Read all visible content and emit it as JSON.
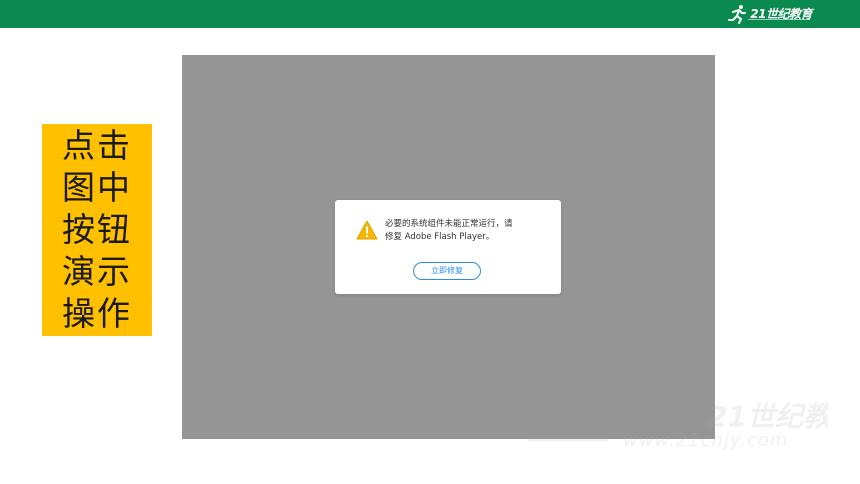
{
  "header": {
    "brand_logo_text": "21世纪教育",
    "brand_url_text": "www.21cnjy.com"
  },
  "side_label": {
    "lines": [
      "点击",
      "图中",
      "按钮",
      "演示",
      "操作"
    ]
  },
  "dialog": {
    "message_line1": "必要的系统组件未能正常运行，请",
    "message_line2": "修复 Adobe Flash Player。",
    "button_label": "立即修复",
    "icon": "warning-icon"
  },
  "watermark": {
    "text": "21世纪教育",
    "url_text": "www.21cnjy.com"
  },
  "colors": {
    "header_bg": "#0a8a4e",
    "label_bg": "#ffc000",
    "flash_area_bg": "#959595",
    "dialog_button": "#2f8fd6",
    "warning_icon": "#f5b700"
  }
}
